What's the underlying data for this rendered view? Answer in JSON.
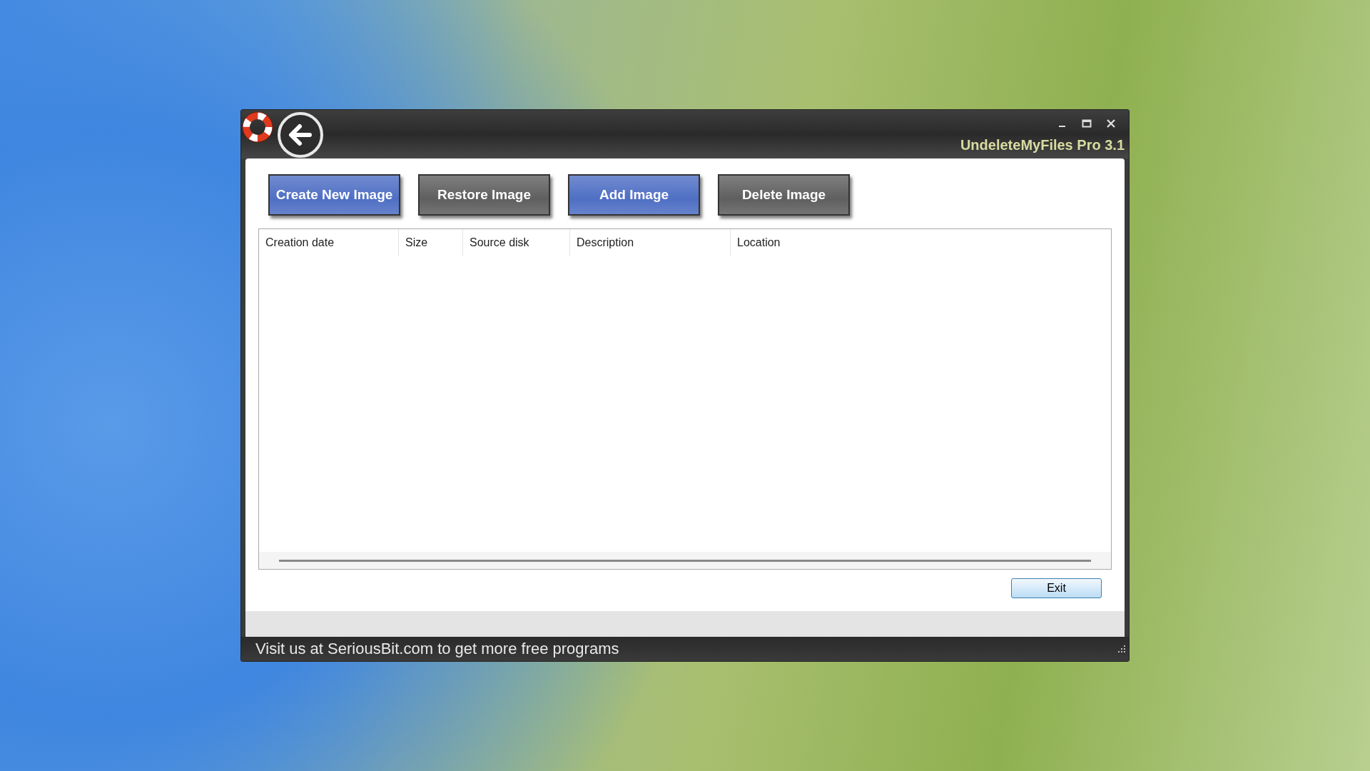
{
  "window": {
    "title": "UndeleteMyFiles Pro 3.1"
  },
  "toolbar": [
    {
      "label": "Create New Image",
      "color": "#4f6fc4"
    },
    {
      "label": "Restore Image",
      "color": "#5f5f5f"
    },
    {
      "label": "Add Image",
      "color": "#4f6fc4"
    },
    {
      "label": "Delete Image",
      "color": "#5f5f5f"
    }
  ],
  "table": {
    "columns": [
      "Creation date",
      "Size",
      "Source disk",
      "Description",
      "Location"
    ]
  },
  "buttons": [
    "Exit"
  ],
  "status_bar": "Visit us at SeriousBit.com to get more free programs"
}
